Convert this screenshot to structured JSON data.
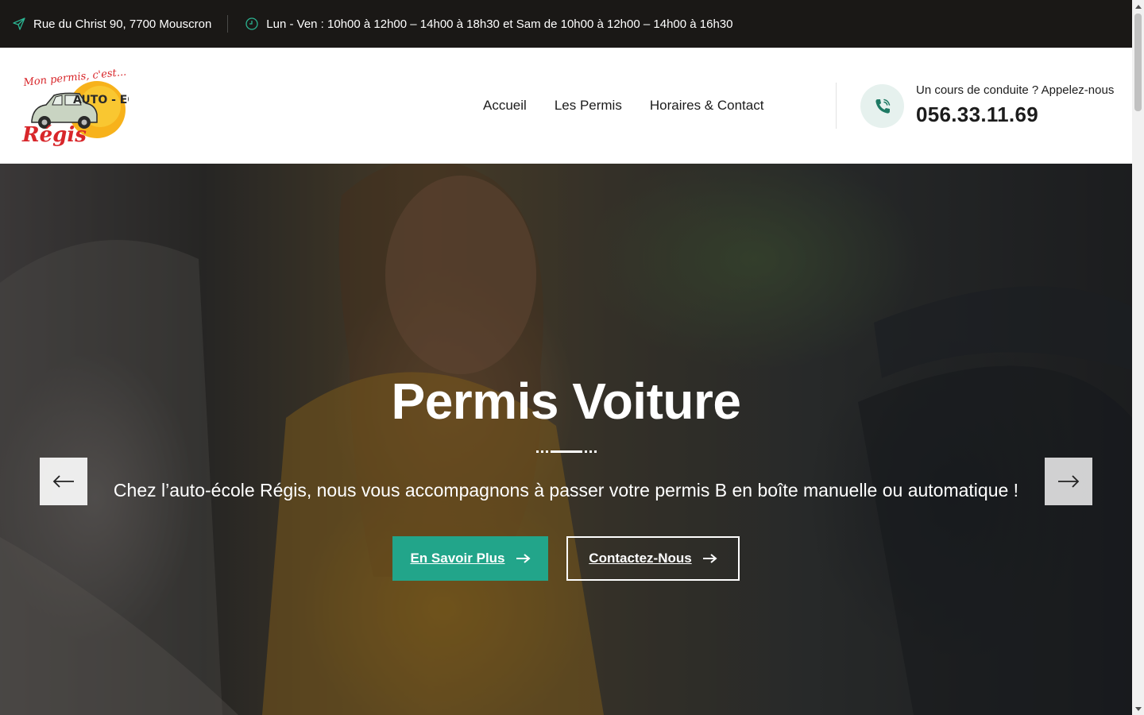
{
  "topbar": {
    "address": "Rue du Christ 90, 7700 Mouscron",
    "hours": "Lun - Ven : 10h00 à 12h00 – 14h00 à 18h30 et Sam de 10h00 à 12h00 – 14h00 à 16h30",
    "icons": [
      "send-icon",
      "clock-icon"
    ]
  },
  "header": {
    "logo": {
      "tagline": "Mon permis, c'est...",
      "name": "Régis",
      "badge": "AUTO - ECOLE"
    },
    "nav": [
      "Accueil",
      "Les Permis",
      "Horaires & Contact"
    ],
    "phone_label": "Un cours de conduite ? Appelez-nous",
    "phone_number": "056.33.11.69"
  },
  "hero": {
    "title": "Permis Voiture",
    "subtitle": "Chez l’auto-école Régis, nous vous accompagnons à passer votre permis B en boîte manuelle ou automatique !",
    "primary_button": "En Savoir Plus",
    "secondary_button": "Contactez-Nous"
  },
  "colors": {
    "topbar_bg": "#1a1816",
    "accent": "#22a58a",
    "icon_accent": "#1f7a64",
    "text_dark": "#1c1c1c"
  }
}
